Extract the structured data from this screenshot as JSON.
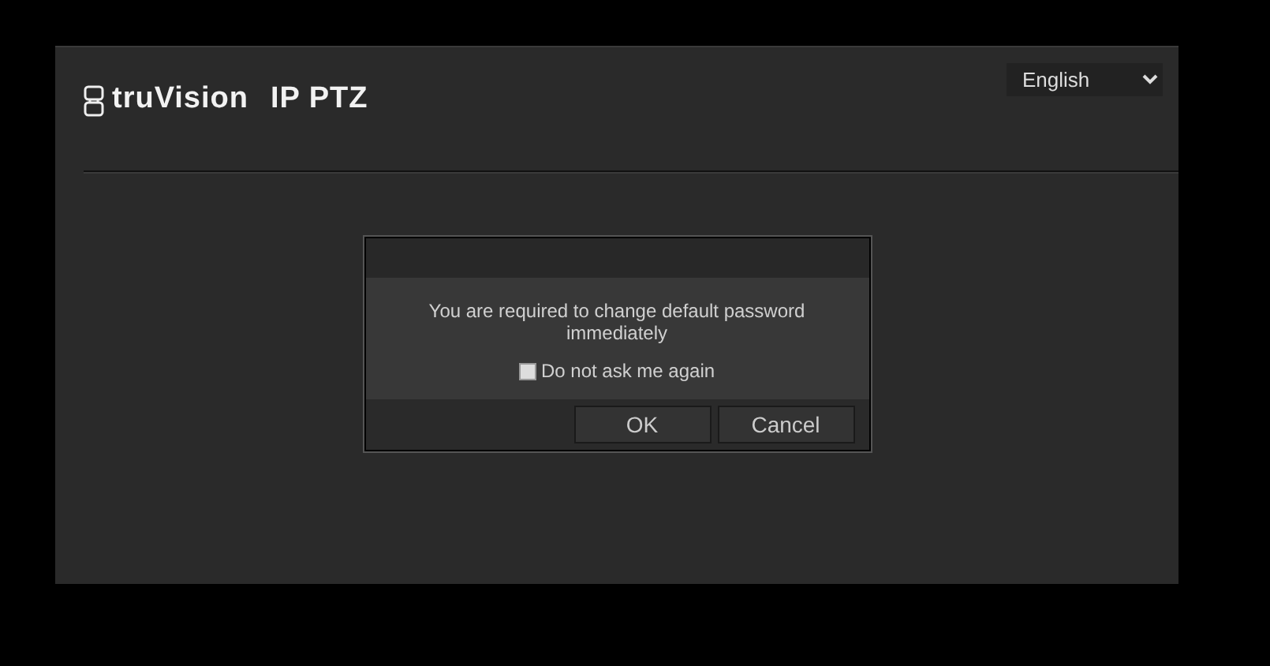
{
  "header": {
    "brand": "truVision",
    "product": "IP PTZ",
    "language": "English"
  },
  "dialog": {
    "message": "You are required to change default password immediately",
    "dont_ask": {
      "label": "Do not ask me again",
      "checked": false
    },
    "buttons": [
      "OK",
      "Cancel"
    ]
  }
}
